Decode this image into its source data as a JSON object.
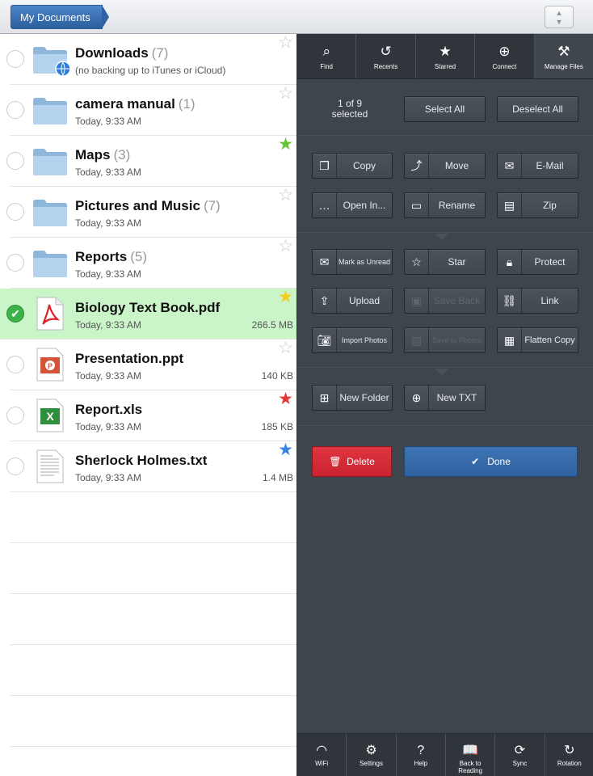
{
  "topbar": {
    "breadcrumb": "My Documents",
    "sort_icon": "sort-arrows-icon"
  },
  "files": [
    {
      "name": "Downloads",
      "count": "(7)",
      "sub": "(no backing up to iTunes or iCloud)",
      "size": "",
      "type": "folder-globe",
      "star": "none",
      "selected": false
    },
    {
      "name": "camera manual",
      "count": "(1)",
      "sub": "Today, 9:33 AM",
      "size": "",
      "type": "folder",
      "star": "none",
      "selected": false
    },
    {
      "name": "Maps",
      "count": "(3)",
      "sub": "Today, 9:33 AM",
      "size": "",
      "type": "folder",
      "star": "green",
      "selected": false
    },
    {
      "name": "Pictures and Music",
      "count": "(7)",
      "sub": "Today, 9:33 AM",
      "size": "",
      "type": "folder",
      "star": "none",
      "selected": false
    },
    {
      "name": "Reports",
      "count": "(5)",
      "sub": "Today, 9:33 AM",
      "size": "",
      "type": "folder",
      "star": "none",
      "selected": false
    },
    {
      "name": "Biology Text Book.pdf",
      "count": "",
      "sub": "Today, 9:33 AM",
      "size": "266.5 MB",
      "type": "pdf",
      "star": "yellow",
      "selected": true
    },
    {
      "name": "Presentation.ppt",
      "count": "",
      "sub": "Today, 9:33 AM",
      "size": "140 KB",
      "type": "ppt",
      "star": "none",
      "selected": false
    },
    {
      "name": "Report.xls",
      "count": "",
      "sub": "Today, 9:33 AM",
      "size": "185 KB",
      "type": "xls",
      "star": "red",
      "selected": false
    },
    {
      "name": "Sherlock Holmes.txt",
      "count": "",
      "sub": "Today, 9:33 AM",
      "size": "1.4 MB",
      "type": "txt",
      "star": "blue",
      "selected": false
    }
  ],
  "colors": {
    "selected_row": "#c9f5c9",
    "panel_bg": "#3e454d",
    "delete": "#d42d38",
    "done": "#3669a8",
    "star_green": "#6cc03a",
    "star_yellow": "#f2cf1d",
    "star_red": "#e23a3a",
    "star_blue": "#3c83e0"
  },
  "tabs": [
    {
      "label": "Find",
      "icon": "search-icon",
      "glyph": "⌕"
    },
    {
      "label": "Recents",
      "icon": "recents-icon",
      "glyph": "↺"
    },
    {
      "label": "Starred",
      "icon": "star-icon",
      "glyph": "★"
    },
    {
      "label": "Connect",
      "icon": "globe-icon",
      "glyph": "⊕"
    },
    {
      "label": "Manage Files",
      "icon": "tools-icon",
      "glyph": "⚒"
    }
  ],
  "selection": {
    "count_text": "1 of 9",
    "selected_text": "selected",
    "select_all": "Select All",
    "deselect_all": "Deselect All"
  },
  "actions": {
    "copy": "Copy",
    "move": "Move",
    "email": "E-Mail",
    "open_in": "Open In...",
    "rename": "Rename",
    "zip": "Zip",
    "mark_unread": "Mark as Unread",
    "star": "Star",
    "protect": "Protect",
    "upload": "Upload",
    "save_back": "Save Back",
    "link": "Link",
    "import_photos": "Import Photos",
    "save_to_photos": "Save to Photos",
    "flatten_copy": "Flatten Copy",
    "new_folder": "New Folder",
    "new_txt": "New TXT",
    "delete": "Delete",
    "done": "Done"
  },
  "bottom": [
    {
      "label": "WiFi",
      "icon": "wifi-icon",
      "glyph": "◠"
    },
    {
      "label": "Settings",
      "icon": "gear-icon",
      "glyph": "⚙"
    },
    {
      "label": "Help",
      "icon": "help-icon",
      "glyph": "?"
    },
    {
      "label": "Back to Reading",
      "icon": "book-icon",
      "glyph": "📖"
    },
    {
      "label": "Sync",
      "icon": "sync-icon",
      "glyph": "⟳"
    },
    {
      "label": "Rotation",
      "icon": "rotation-icon",
      "glyph": "↻"
    }
  ]
}
